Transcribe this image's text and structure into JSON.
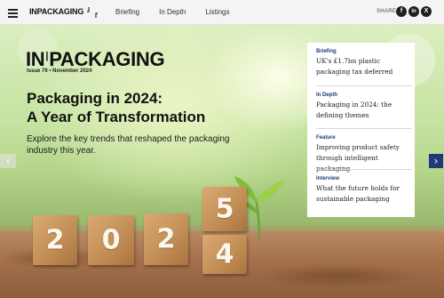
{
  "header": {
    "logo": "INPACKAGING",
    "nav": [
      "Briefing",
      "In Depth",
      "Listings"
    ],
    "share_label": "SHARE",
    "social": [
      {
        "icon": "facebook-icon",
        "glyph": "f"
      },
      {
        "icon": "linkedin-icon",
        "glyph": "in"
      },
      {
        "icon": "x-icon",
        "glyph": "X"
      }
    ]
  },
  "hero": {
    "brand_left": "IN",
    "brand_sep": "|",
    "brand_right": "PACKAGING",
    "issue": "Issue 76 • November 2024",
    "headline_line1": "Packaging in 2024:",
    "headline_line2": "A Year of Transformation",
    "subtitle": "Explore the key trends that reshaped the packaging industry this year.",
    "blocks": [
      "2",
      "0",
      "2",
      "5",
      "4"
    ]
  },
  "panel": {
    "items": [
      {
        "category": "Briefing",
        "title": "UK's £1.7bn plastic packaging tax deferred"
      },
      {
        "category": "In Depth",
        "title": "Packaging in 2024: the defining themes"
      },
      {
        "category": "Feature",
        "title": "Improving product safety through intelligent packaging"
      },
      {
        "category": "Interview",
        "title": "What the future holds for sustainable packaging"
      }
    ]
  },
  "colors": {
    "accent": "#1e3a78",
    "topbar": "#f4f4f4"
  }
}
